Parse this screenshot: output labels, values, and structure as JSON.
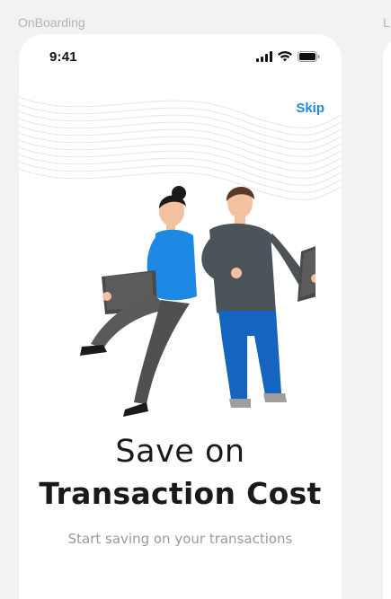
{
  "canvas": {
    "frame_label": "OnBoarding",
    "next_frame_label": "L"
  },
  "status_bar": {
    "time": "9:41",
    "icons": [
      "signal-icon",
      "wifi-icon",
      "battery-icon"
    ]
  },
  "header": {
    "skip_label": "Skip"
  },
  "illustration": {
    "name": "two-people-with-tablets-illustration"
  },
  "content": {
    "title_line1": "Save on",
    "title_line2": "Transaction Cost",
    "subtitle": "Start saving on your transactions"
  },
  "colors": {
    "background": "#f2f2f2",
    "card": "#ffffff",
    "accent": "#1a8be6",
    "title": "#1a1a1a",
    "subtitle": "#9a9a9a"
  }
}
